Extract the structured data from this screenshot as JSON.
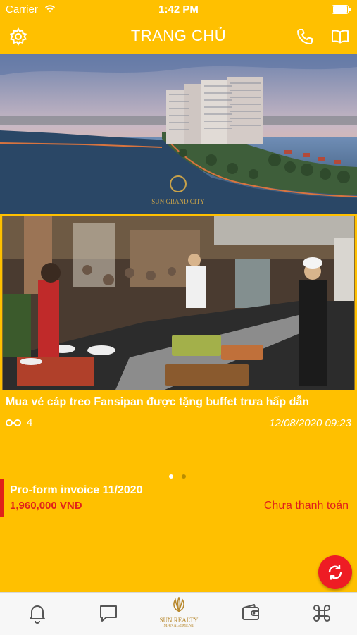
{
  "status_bar": {
    "carrier": "Carrier",
    "time": "1:42 PM"
  },
  "header": {
    "title": "TRANG CHỦ",
    "left_icon": "gear-icon",
    "right_icons": [
      "phone-icon",
      "book-icon"
    ]
  },
  "banner": {
    "logo_text": "SUN GRAND CITY"
  },
  "news": {
    "title": "Mua vé cáp treo Fansipan được tặng buffet trưa hấp dẫn",
    "views": "4",
    "date": "12/08/2020 09:23"
  },
  "carousel": {
    "pages": 2,
    "active_index": 0
  },
  "invoice": {
    "name": "Pro-form invoice 11/2020",
    "amount": "1,960,000 VNĐ",
    "status": "Chưa thanh toán"
  },
  "fab": {
    "icon": "refresh-icon"
  },
  "tab_bar": {
    "items": [
      {
        "icon": "bell-icon"
      },
      {
        "icon": "chat-icon"
      },
      {
        "icon": "sun-realty-logo",
        "label_line1": "SUN REALTY",
        "label_line2": "MANAGEMENT"
      },
      {
        "icon": "wallet-icon"
      },
      {
        "icon": "command-icon"
      }
    ]
  },
  "colors": {
    "background": "#ffc000",
    "accent_red": "#e0201a",
    "text_white": "#ffffff",
    "tab_bar": "#f7f7f7",
    "logo_gold": "#b8892f"
  }
}
